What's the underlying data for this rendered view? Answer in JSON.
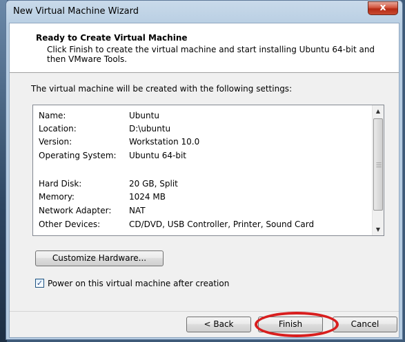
{
  "window": {
    "title": "New Virtual Machine Wizard",
    "close_label": "x"
  },
  "header": {
    "title": "Ready to Create Virtual Machine",
    "subtitle": "Click Finish to create the virtual machine and start installing Ubuntu 64-bit and then VMware Tools."
  },
  "settings": {
    "intro": "The virtual machine will be created with the following settings:",
    "rows": [
      {
        "key": "Name:",
        "value": "Ubuntu"
      },
      {
        "key": "Location:",
        "value": "D:\\ubuntu"
      },
      {
        "key": "Version:",
        "value": "Workstation 10.0"
      },
      {
        "key": "Operating System:",
        "value": "Ubuntu 64-bit"
      },
      {
        "key": "Hard Disk:",
        "value": "20 GB, Split"
      },
      {
        "key": "Memory:",
        "value": "1024 MB"
      },
      {
        "key": "Network Adapter:",
        "value": "NAT"
      },
      {
        "key": "Other Devices:",
        "value": "CD/DVD, USB Controller, Printer, Sound Card"
      }
    ]
  },
  "buttons": {
    "customize": "Customize Hardware...",
    "back": "< Back",
    "finish": "Finish",
    "cancel": "Cancel"
  },
  "power_on": {
    "label": "Power on this virtual machine after creation",
    "checked": true
  },
  "icons": {
    "scroll_up": "scroll-up-icon",
    "scroll_down": "scroll-down-icon",
    "close": "close-icon"
  },
  "colors": {
    "highlight": "#d81e1e"
  }
}
